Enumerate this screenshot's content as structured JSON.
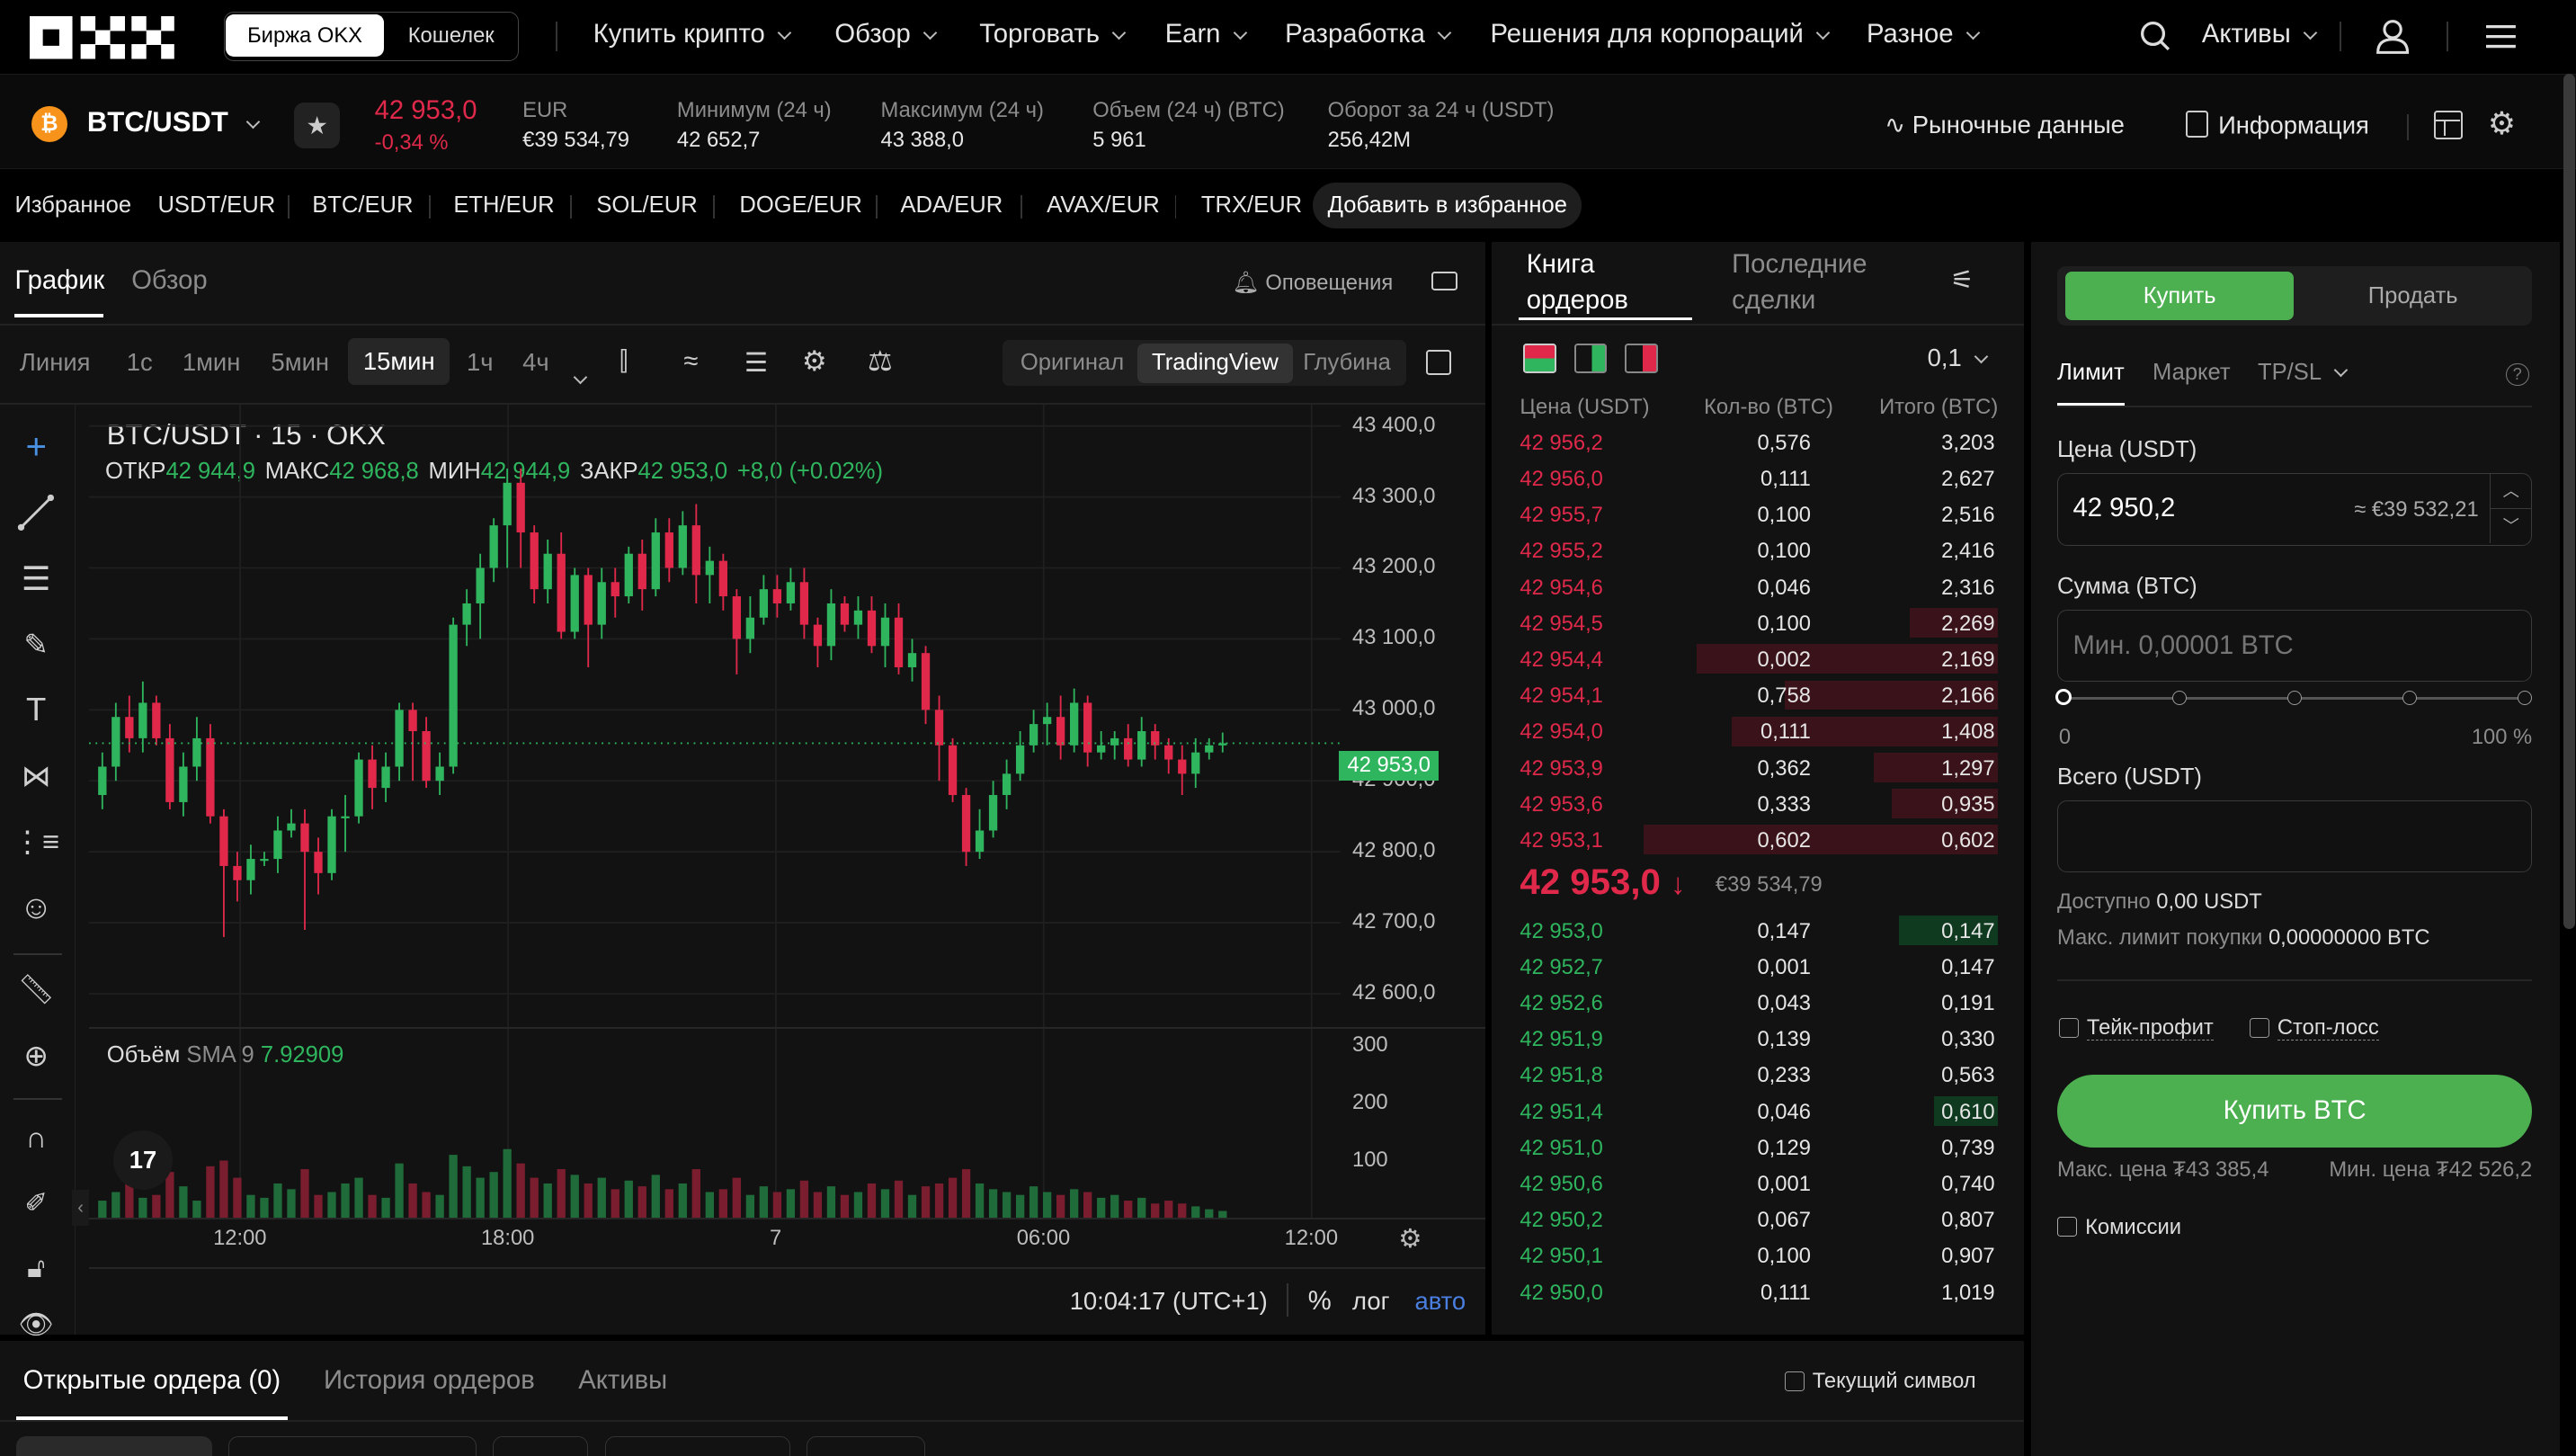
{
  "nav": {
    "toggle": [
      "Биржа OKX",
      "Кошелек"
    ],
    "items": [
      "Купить крипто",
      "Обзор",
      "Торговать",
      "Earn",
      "Разработка",
      "Решения для корпораций",
      "Разное"
    ],
    "assets": "Активы"
  },
  "pair": {
    "name": "BTC/USDT",
    "price": "42 953,0",
    "change": "-0,34 %",
    "eur_label": "EUR",
    "eur_value": "€39 534,79",
    "low_label": "Минимум (24 ч)",
    "low_value": "42 652,7",
    "high_label": "Максимум (24 ч)",
    "high_value": "43 388,0",
    "vol_label": "Объем (24 ч) (BTC)",
    "vol_value": "5 961",
    "turn_label": "Оборот за 24 ч (USDT)",
    "turn_value": "256,42M",
    "market_data": "Рыночные данные",
    "info": "Информация"
  },
  "favorites": {
    "label": "Избранное",
    "pairs": [
      "USDT/EUR",
      "BTC/EUR",
      "ETH/EUR",
      "SOL/EUR",
      "DOGE/EUR",
      "ADA/EUR",
      "AVAX/EUR",
      "TRX/EUR"
    ],
    "add": "Добавить в избранное"
  },
  "chart": {
    "tabs": [
      "График",
      "Обзор"
    ],
    "alerts": "Оповещения",
    "intervals": [
      "Линия",
      "1с",
      "1мин",
      "5мин",
      "15мин",
      "1ч",
      "4ч"
    ],
    "modes": [
      "Оригинал",
      "TradingView",
      "Глубина"
    ],
    "legend_title": "BTC/USDT · 15 · OKX",
    "ohlc": [
      {
        "k": "ОТКР",
        "v": "42 944,9"
      },
      {
        "k": "МАКС",
        "v": "42 968,8"
      },
      {
        "k": "МИН",
        "v": "42 944,9"
      },
      {
        "k": "ЗАКР",
        "v": "42 953,0"
      }
    ],
    "chg": "+8,0 (+0.02%)",
    "vol_label": "Объём",
    "vol_sma": "SMA 9",
    "vol_value": "7.92909",
    "time": "10:04:17 (UTC+1)",
    "opts": [
      "%",
      "лог",
      "авто"
    ],
    "price_ticks": [
      "43 400,0",
      "43 300,0",
      "43 200,0",
      "43 100,0",
      "43 000,0",
      "42 900,0",
      "42 800,0",
      "42 700,0",
      "42 600,0"
    ],
    "current_price": "42 953,0",
    "vol_ticks": [
      "300",
      "200",
      "100"
    ],
    "time_ticks": [
      "12:00",
      "18:00",
      "7",
      "06:00",
      "12:00"
    ]
  },
  "chart_data": {
    "type": "candlestick",
    "ylim": [
      42550,
      43430
    ],
    "current": 42953.0,
    "candles": [
      [
        42880,
        42920,
        42860,
        42940
      ],
      [
        42920,
        42990,
        42900,
        43010
      ],
      [
        42990,
        42960,
        42940,
        43020
      ],
      [
        42960,
        43010,
        42940,
        43040
      ],
      [
        43010,
        42960,
        42950,
        43020
      ],
      [
        42960,
        42870,
        42860,
        42980
      ],
      [
        42870,
        42920,
        42850,
        42940
      ],
      [
        42920,
        42960,
        42900,
        42990
      ],
      [
        42960,
        42850,
        42840,
        42980
      ],
      [
        42850,
        42780,
        42680,
        42860
      ],
      [
        42780,
        42760,
        42730,
        42800
      ],
      [
        42760,
        42790,
        42740,
        42810
      ],
      [
        42790,
        42790,
        42780,
        42800
      ],
      [
        42790,
        42830,
        42770,
        42850
      ],
      [
        42830,
        42840,
        42820,
        42860
      ],
      [
        42840,
        42800,
        42690,
        42860
      ],
      [
        42800,
        42770,
        42740,
        42820
      ],
      [
        42770,
        42850,
        42760,
        42860
      ],
      [
        42850,
        42850,
        42800,
        42880
      ],
      [
        42850,
        42930,
        42840,
        42940
      ],
      [
        42930,
        42890,
        42860,
        42950
      ],
      [
        42890,
        42920,
        42870,
        42940
      ],
      [
        42920,
        43000,
        42900,
        43010
      ],
      [
        43000,
        42970,
        42900,
        43010
      ],
      [
        42970,
        42900,
        42890,
        42990
      ],
      [
        42900,
        42920,
        42880,
        42940
      ],
      [
        42920,
        43120,
        42910,
        43130
      ],
      [
        43120,
        43150,
        43090,
        43170
      ],
      [
        43150,
        43200,
        43100,
        43220
      ],
      [
        43200,
        43260,
        43180,
        43270
      ],
      [
        43260,
        43320,
        43200,
        43340
      ],
      [
        43320,
        43250,
        43200,
        43340
      ],
      [
        43250,
        43170,
        43150,
        43260
      ],
      [
        43170,
        43220,
        43150,
        43240
      ],
      [
        43220,
        43110,
        43100,
        43250
      ],
      [
        43110,
        43190,
        43100,
        43200
      ],
      [
        43190,
        43120,
        43060,
        43200
      ],
      [
        43120,
        43180,
        43100,
        43200
      ],
      [
        43180,
        43160,
        43130,
        43200
      ],
      [
        43160,
        43220,
        43150,
        43230
      ],
      [
        43220,
        43170,
        43140,
        43240
      ],
      [
        43170,
        43250,
        43160,
        43270
      ],
      [
        43250,
        43200,
        43180,
        43270
      ],
      [
        43200,
        43260,
        43190,
        43280
      ],
      [
        43260,
        43190,
        43150,
        43290
      ],
      [
        43190,
        43210,
        43150,
        43230
      ],
      [
        43210,
        43160,
        43140,
        43220
      ],
      [
        43160,
        43100,
        43050,
        43170
      ],
      [
        43100,
        43130,
        43080,
        43160
      ],
      [
        43130,
        43170,
        43120,
        43190
      ],
      [
        43170,
        43150,
        43130,
        43190
      ],
      [
        43150,
        43180,
        43140,
        43200
      ],
      [
        43180,
        43120,
        43100,
        43200
      ],
      [
        43120,
        43090,
        43060,
        43130
      ],
      [
        43090,
        43150,
        43070,
        43170
      ],
      [
        43150,
        43120,
        43110,
        43160
      ],
      [
        43120,
        43140,
        43100,
        43160
      ],
      [
        43140,
        43090,
        43080,
        43160
      ],
      [
        43090,
        43130,
        43060,
        43150
      ],
      [
        43130,
        43060,
        43050,
        43150
      ],
      [
        43060,
        43080,
        43040,
        43100
      ],
      [
        43080,
        43000,
        42980,
        43090
      ],
      [
        43000,
        42950,
        42900,
        43020
      ],
      [
        42950,
        42880,
        42870,
        42960
      ],
      [
        42880,
        42800,
        42780,
        42890
      ],
      [
        42800,
        42830,
        42790,
        42860
      ],
      [
        42830,
        42880,
        42820,
        42900
      ],
      [
        42880,
        42910,
        42860,
        42930
      ],
      [
        42910,
        42950,
        42900,
        42970
      ],
      [
        42950,
        42980,
        42940,
        43000
      ],
      [
        42980,
        42990,
        42950,
        43010
      ],
      [
        42990,
        42950,
        42930,
        43020
      ],
      [
        42950,
        43010,
        42940,
        43030
      ],
      [
        43010,
        42940,
        42920,
        43020
      ],
      [
        42940,
        42950,
        42930,
        42970
      ],
      [
        42950,
        42960,
        42930,
        42970
      ],
      [
        42960,
        42930,
        42920,
        42980
      ],
      [
        42930,
        42970,
        42920,
        42990
      ],
      [
        42970,
        42950,
        42930,
        42980
      ],
      [
        42950,
        42930,
        42910,
        42960
      ],
      [
        42930,
        42910,
        42880,
        42950
      ],
      [
        42910,
        42940,
        42890,
        42960
      ],
      [
        42940,
        42950,
        42930,
        42960
      ],
      [
        42950,
        42953,
        42940,
        42968
      ]
    ],
    "volume": [
      30,
      45,
      60,
      35,
      40,
      80,
      55,
      30,
      90,
      100,
      70,
      40,
      35,
      60,
      50,
      85,
      40,
      45,
      60,
      70,
      40,
      35,
      95,
      60,
      45,
      40,
      110,
      90,
      70,
      80,
      120,
      95,
      70,
      60,
      85,
      75,
      60,
      70,
      50,
      65,
      55,
      75,
      50,
      60,
      85,
      45,
      50,
      70,
      40,
      55,
      45,
      50,
      65,
      45,
      55,
      40,
      45,
      60,
      50,
      65,
      40,
      55,
      60,
      70,
      85,
      60,
      50,
      45,
      40,
      55,
      45,
      40,
      50,
      45,
      35,
      40,
      30,
      35,
      25,
      30,
      25,
      20,
      15,
      12
    ]
  },
  "book": {
    "tabs": [
      "Книга ордеров",
      "Последние сделки"
    ],
    "step": "0,1",
    "headers": [
      "Цена (USDT)",
      "Кол-во (BTC)",
      "Итого (BTC)"
    ],
    "asks": [
      [
        "42 956,2",
        "0,576",
        "3,203",
        0
      ],
      [
        "42 956,0",
        "0,111",
        "2,627",
        0
      ],
      [
        "42 955,7",
        "0,100",
        "2,516",
        0
      ],
      [
        "42 955,2",
        "0,100",
        "2,416",
        0
      ],
      [
        "42 954,6",
        "0,046",
        "2,316",
        0
      ],
      [
        "42 954,5",
        "0,100",
        "2,269",
        0.25
      ],
      [
        "42 954,4",
        "0,002",
        "2,169",
        0.85
      ],
      [
        "42 954,1",
        "0,758",
        "2,166",
        0.6
      ],
      [
        "42 954,0",
        "0,111",
        "1,408",
        0.75
      ],
      [
        "42 953,9",
        "0,362",
        "1,297",
        0.35
      ],
      [
        "42 953,6",
        "0,333",
        "0,935",
        0.3
      ],
      [
        "42 953,1",
        "0,602",
        "0,602",
        1.0
      ]
    ],
    "mid_price": "42 953,0",
    "mid_eur": "€39 534,79",
    "bids": [
      [
        "42 953,0",
        "0,147",
        "0,147",
        0.28
      ],
      [
        "42 952,7",
        "0,001",
        "0,147",
        0
      ],
      [
        "42 952,6",
        "0,043",
        "0,191",
        0
      ],
      [
        "42 951,9",
        "0,139",
        "0,330",
        0
      ],
      [
        "42 951,8",
        "0,233",
        "0,563",
        0
      ],
      [
        "42 951,4",
        "0,046",
        "0,610",
        0.18
      ],
      [
        "42 951,0",
        "0,129",
        "0,739",
        0
      ],
      [
        "42 950,6",
        "0,001",
        "0,740",
        0
      ],
      [
        "42 950,2",
        "0,067",
        "0,807",
        0
      ],
      [
        "42 950,1",
        "0,100",
        "0,907",
        0
      ],
      [
        "42 950,0",
        "0,111",
        "1,019",
        0
      ]
    ]
  },
  "trade": {
    "buy": "Купить",
    "sell": "Продать",
    "types": [
      "Лимит",
      "Маркет",
      "TP/SL"
    ],
    "price_label": "Цена (USDT)",
    "price_value": "42 950,2",
    "price_eur": "≈ €39 532,21",
    "amount_label": "Сумма (BTC)",
    "amount_placeholder": "Мин. 0,00001 BTC",
    "slider_min": "0",
    "slider_max": "100 %",
    "total_label": "Всего (USDT)",
    "avail_label": "Доступно",
    "avail_value": "0,00 USDT",
    "maxbuy_label": "Макс. лимит покупки",
    "maxbuy_value": "0,00000000 BTC",
    "tp": "Тейк-профит",
    "sl": "Стоп-лосс",
    "buy_btn": "Купить BTC",
    "max_price": "Макс. цена ₮43 385,4",
    "min_price": "Мин. цена ₮42 526,2",
    "fees": "Комиссии"
  },
  "orders": {
    "tabs": [
      "Открытые ордера (0)",
      "История ордеров",
      "Активы"
    ],
    "current_symbol": "Текущий символ"
  },
  "colors": {
    "up": "#2fb55e",
    "down": "#e0294a",
    "accent": "#4caf50"
  }
}
